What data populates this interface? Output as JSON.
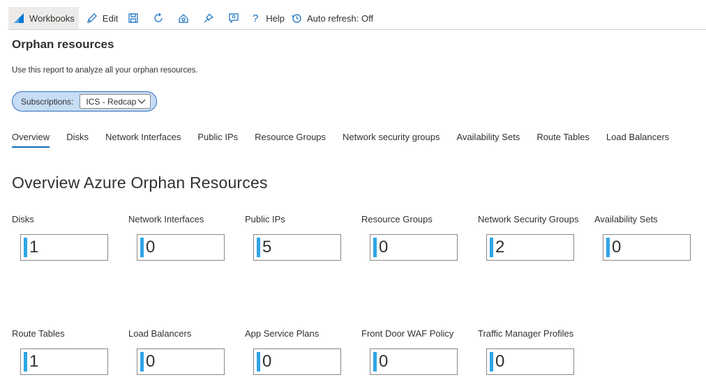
{
  "toolbar": {
    "workbooks_label": "Workbooks",
    "edit_label": "Edit",
    "help_label": "Help",
    "auto_refresh_label": "Auto refresh: Off",
    "icons": [
      "workbooks-icon",
      "edit-icon",
      "save-icon",
      "refresh-icon",
      "share-icon",
      "pin-icon",
      "feedback-icon",
      "help-icon",
      "auto-refresh-icon"
    ]
  },
  "page": {
    "title": "Orphan resources",
    "description": "Use this report to analyze all your orphan resources."
  },
  "parameters": {
    "subscriptions_label": "Subscriptions:",
    "subscriptions_value": "ICS - Redcap"
  },
  "tabs": [
    {
      "label": "Overview",
      "active": true
    },
    {
      "label": "Disks",
      "active": false
    },
    {
      "label": "Network Interfaces",
      "active": false
    },
    {
      "label": "Public IPs",
      "active": false
    },
    {
      "label": "Resource Groups",
      "active": false
    },
    {
      "label": "Network security groups",
      "active": false
    },
    {
      "label": "Availability Sets",
      "active": false
    },
    {
      "label": "Route Tables",
      "active": false
    },
    {
      "label": "Load Balancers",
      "active": false
    }
  ],
  "overview": {
    "title": "Overview Azure Orphan Resources",
    "tiles": [
      {
        "label": "Disks",
        "value": "1"
      },
      {
        "label": "Network Interfaces",
        "value": "0"
      },
      {
        "label": "Public IPs",
        "value": "5"
      },
      {
        "label": "Resource Groups",
        "value": "0"
      },
      {
        "label": "Network Security Groups",
        "value": "2"
      },
      {
        "label": "Availability Sets",
        "value": "0"
      },
      {
        "label": "Route Tables",
        "value": "1"
      },
      {
        "label": "Load Balancers",
        "value": "0"
      },
      {
        "label": "App Service Plans",
        "value": "0"
      },
      {
        "label": "Front Door WAF Policy",
        "value": "0"
      },
      {
        "label": "Traffic Manager Profiles",
        "value": "0"
      }
    ]
  },
  "colors": {
    "accent": "#0f6cbd",
    "tile_bar": "#2fa4e7",
    "pill_bg": "#c7dcf5",
    "pill_border": "#2f6fb8"
  }
}
